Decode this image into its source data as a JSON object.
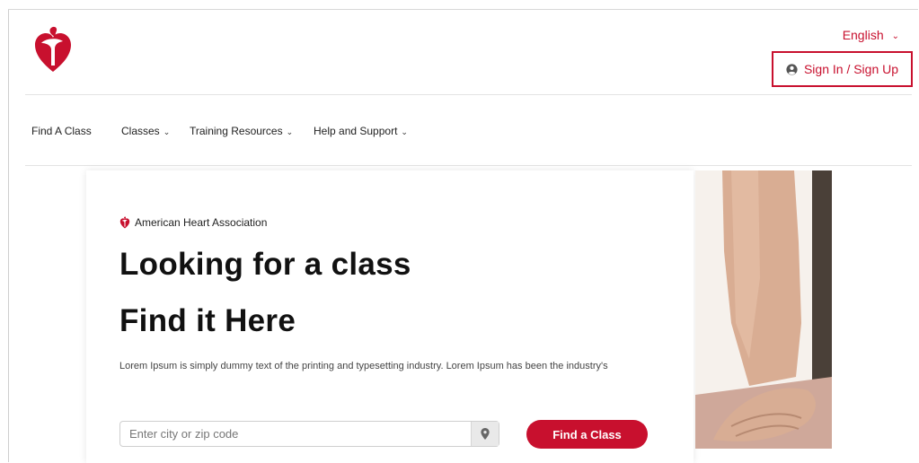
{
  "header": {
    "language": "English",
    "signin_label": "Sign In / Sign Up"
  },
  "nav": {
    "items": [
      {
        "label": "Find A Class"
      },
      {
        "label": "Classes"
      },
      {
        "label": "Training Resources"
      },
      {
        "label": "Help and Support"
      }
    ]
  },
  "hero": {
    "brand": "American Heart Association",
    "title_line1": "Looking for a class",
    "title_line2": "Find it Here",
    "description": "Lorem Ipsum is simply dummy text of the printing and typesetting industry. Lorem Ipsum has been the industry's",
    "search_placeholder": "Enter city or zip code",
    "find_button": "Find a Class"
  },
  "colors": {
    "brand_red": "#c8102e"
  },
  "icons": {
    "logo": "heart-torch-logo",
    "user": "user-circle-icon",
    "location": "location-pin-icon",
    "chevron": "chevron-down-icon"
  }
}
